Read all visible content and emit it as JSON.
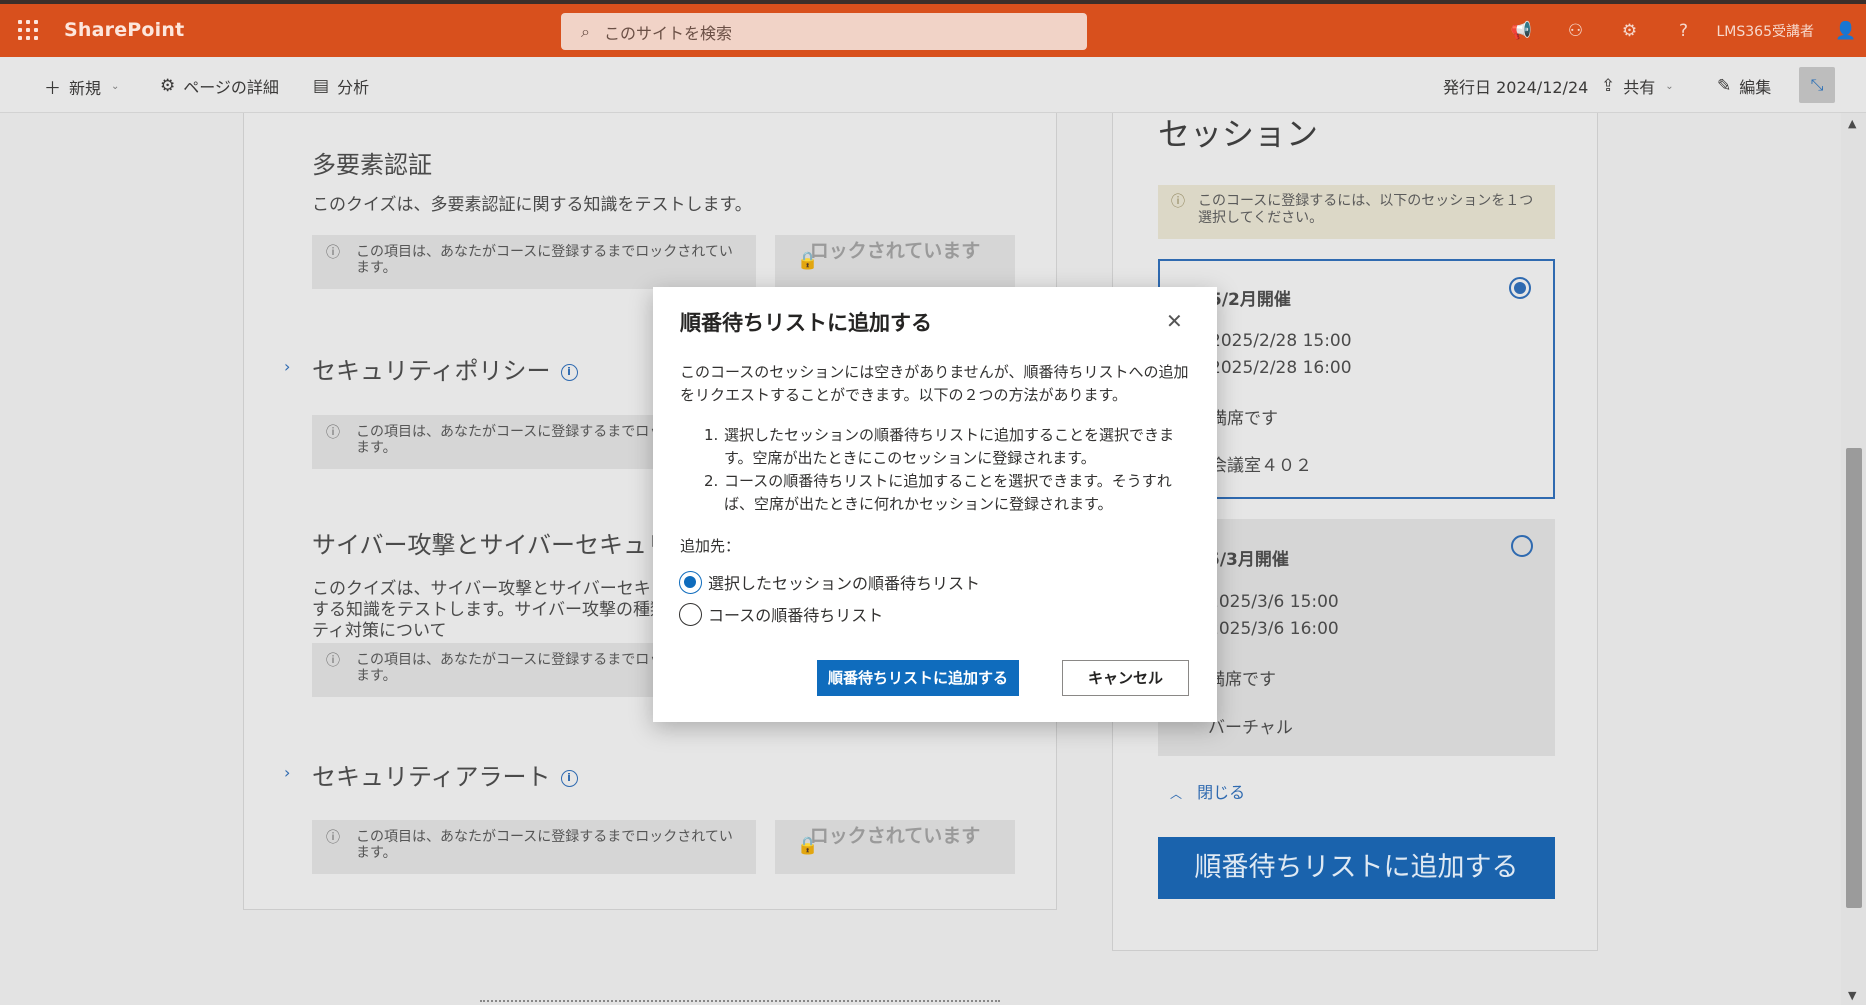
{
  "suitebar": {
    "app_name": "SharePoint",
    "search_placeholder": "このサイトを検索",
    "user_name": "LMS365受講者"
  },
  "commandbar": {
    "new_label": "新規",
    "page_details_label": "ページの詳細",
    "analytics_label": "分析",
    "published_label": "発行日 2024/12/24",
    "share_label": "共有",
    "edit_label": "編集"
  },
  "quizzes": [
    {
      "title": "多要素認証",
      "description": "このクイズは、多要素認証に関する知識をテストします。",
      "lock_info": "この項目は、あなたがコースに登録するまでロックされています。",
      "lock_button": "ロックされています"
    },
    {
      "title": "セキュリティポリシー",
      "lock_info": "この項目は、あなたがコースに登録するまでロックされています。"
    },
    {
      "title": "サイバー攻撃とサイバーセキュリティ",
      "description": "このクイズは、サイバー攻撃とサイバーセキュリティに関する知識をテストします。サイバー攻撃の種類やセキュリティ対策について",
      "lock_info": "この項目は、あなたがコースに登録するまでロックされています。"
    },
    {
      "title": "セキュリティアラート",
      "lock_info": "この項目は、あなたがコースに登録するまでロックされています。",
      "lock_button": "ロックされています"
    }
  ],
  "sessions_panel": {
    "title": "セッション",
    "notice": "このコースに登録するには、以下のセッションを１つ選択してください。",
    "sessions": [
      {
        "name": "5/2月開催",
        "start": "2025/2/28 15:00",
        "end": "2025/2/28 16:00",
        "seats": "満席です",
        "location": "会議室４０２",
        "selected": true
      },
      {
        "name": "5/3月開催",
        "start": "2025/3/6 15:00",
        "end": "2025/3/6 16:00",
        "seats": "満席です",
        "location": "バーチャル",
        "selected": false
      }
    ],
    "close_label": "閉じる",
    "waitlist_button": "順番待ちリストに追加する"
  },
  "modal": {
    "title": "順番待ちリストに追加する",
    "intro": "このコースのセッションには空きがありませんが、順番待ちリストへの追加をリクエストすることができます。以下の２つの方法があります。",
    "options_text": [
      "選択したセッションの順番待ちリストに追加することを選択できます。空席が出たときにこのセッションに登録されます。",
      "コースの順番待ちリストに追加することを選択できます。そうすれば、空席が出たときに何れかセッションに登録されます。"
    ],
    "add_to_label": "追加先：",
    "radio_options": [
      {
        "label": "選択したセッションの順番待ちリスト",
        "checked": true
      },
      {
        "label": "コースの順番待ちリスト",
        "checked": false
      }
    ],
    "primary_button": "順番待ちリストに追加する",
    "cancel_button": "キャンセル"
  },
  "colors": {
    "suitebar": "#d8501d",
    "accent": "#0f6cbd"
  }
}
